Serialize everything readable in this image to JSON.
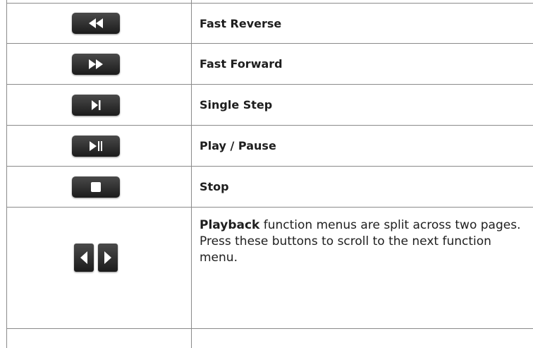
{
  "rows": [
    {
      "icon": "fast-reverse-icon",
      "label": "Fast Reverse"
    },
    {
      "icon": "fast-forward-icon",
      "label": "Fast Forward"
    },
    {
      "icon": "single-step-icon",
      "label": "Single Step"
    },
    {
      "icon": "play-pause-icon",
      "label": "Play / Pause"
    },
    {
      "icon": "stop-icon",
      "label": "Stop"
    }
  ],
  "nav_row": {
    "icons": [
      "page-left-icon",
      "page-right-icon"
    ],
    "description_bold": "Playback",
    "description_rest": " function menus are split across two pages. Press these buttons to scroll to the next function menu."
  },
  "colors": {
    "button": "#2a2a2a",
    "glyph": "#ffffff",
    "border": "#8a8a8a"
  }
}
